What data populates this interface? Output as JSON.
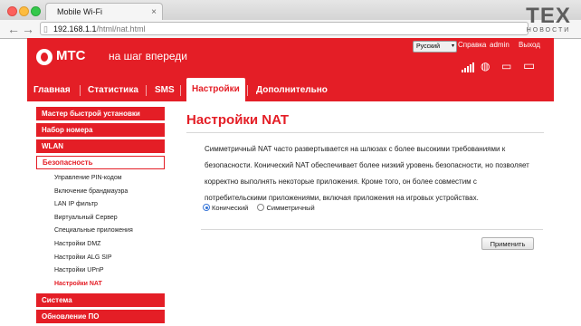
{
  "browser": {
    "tab_title": "Mobile Wi-Fi",
    "tab_close": "×",
    "url_host": "192.168.1.1",
    "url_path": "/html/nat.html"
  },
  "watermark": {
    "big": "TEX",
    "small": "НОВОСТИ"
  },
  "header": {
    "brand": "МТС",
    "slogan": "на шаг впереди",
    "language": "Русский",
    "help": "Справка",
    "user": "admin",
    "logout": "Выход",
    "accent_color": "#e41e26"
  },
  "menu": [
    "Главная",
    "Статистика",
    "SMS",
    "Настройки",
    "Дополнительно"
  ],
  "sidebar": {
    "main_top": [
      "Мастер быстрой установки",
      "Набор номера",
      "WLAN",
      "Безопасность"
    ],
    "sub": [
      "Управление PIN-кодом",
      "Включение брандмауэра",
      "LAN IP фильтр",
      "Виртуальный Сервер",
      "Специальные приложения",
      "Настройки DMZ",
      "Настройки ALG SIP",
      "Настройки UPnP",
      "Настройки NAT"
    ],
    "main_bottom": [
      "Система",
      "Обновление ПО"
    ]
  },
  "content": {
    "title": "Настройки NAT",
    "description": "Симметричный NAT часто развертывается на шлюзах с более высокими требованиями к безопасности. Конический NAT обеспечивает более низкий уровень безопасности, но позволяет корректно выполнять некоторые приложения. Кроме того, он более совместим с потребительскими приложениями, включая приложения на игровых устройствах.",
    "option_cone": "Конический",
    "option_symmetric": "Симметричный",
    "selected": "Конический",
    "apply": "Применить"
  }
}
